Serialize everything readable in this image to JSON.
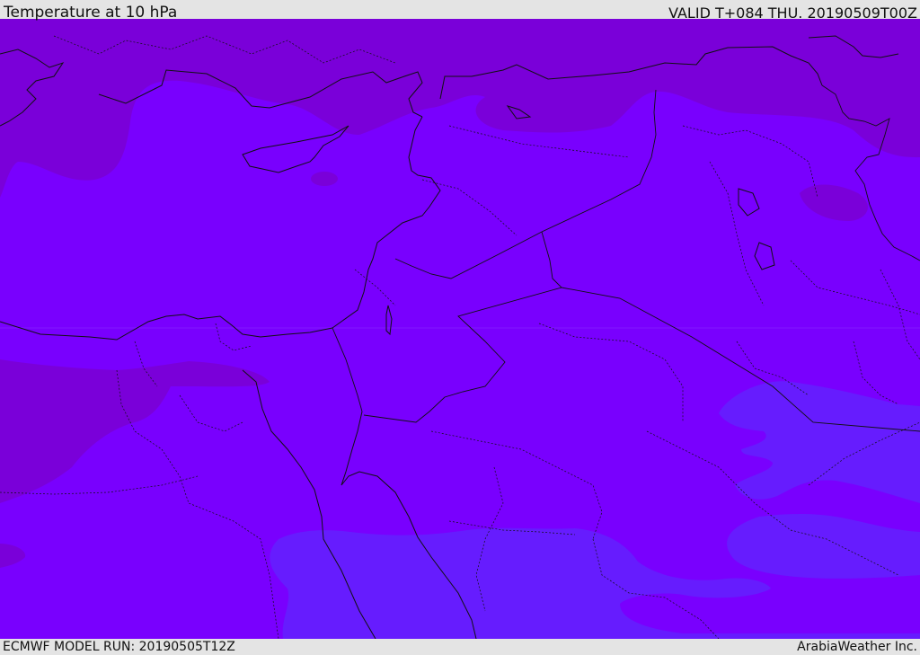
{
  "header": {
    "title": "Temperature at 10 hPa",
    "valid_time": "VALID T+084 THU. 20190509T00Z"
  },
  "footer": {
    "model_run": "ECMWF MODEL RUN: 20190505T12Z",
    "brand": "ArabiaWeather Inc."
  },
  "map": {
    "colors": {
      "base": "#7900fe",
      "warm_band": "#7a00d9",
      "cool_band": "#661cfe",
      "border": "#111111"
    }
  }
}
